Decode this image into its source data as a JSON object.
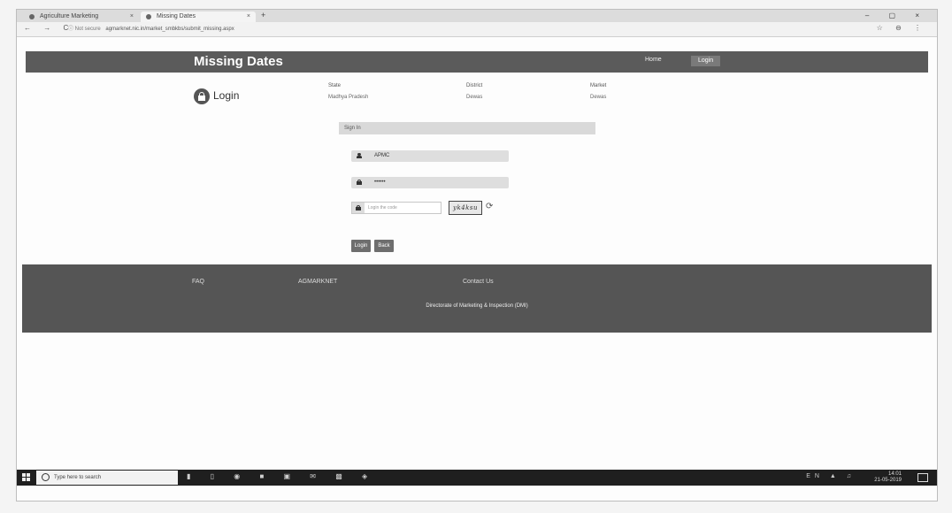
{
  "browser": {
    "tabs": [
      {
        "label": "Agriculture Marketing"
      },
      {
        "label": "Missing Dates"
      }
    ],
    "new_tab": "+",
    "window_controls": "–  ▢  ×",
    "nav": "←  →  C",
    "security": "ⓘ Not secure",
    "url": "agmarknet.nic.in/market_smbkbs/submit_missing.aspx",
    "right_icons": "☆  ⊖  ⋮"
  },
  "header": {
    "title": "Missing Dates",
    "home": "Home",
    "login": "Login"
  },
  "login_heading": "Login",
  "info": {
    "state_label": "State",
    "state_value": "Madhya Pradesh",
    "district_label": "District",
    "district_value": "Dewas",
    "market_label": "Market",
    "market_value": "Dewas"
  },
  "form": {
    "sign_in": "Sign In",
    "username": "APMC",
    "password": "••••••",
    "captcha_placeholder": "Login the code",
    "captcha_text": "yk4ksu",
    "login_button": "Login",
    "back_button": "Back"
  },
  "footer": {
    "links": [
      "FAQ",
      "AGMARKNET",
      "Contact Us"
    ],
    "copyright": "Directorate of Marketing & Inspection (DMI)"
  },
  "taskbar": {
    "search_placeholder": "Type here to search",
    "tray_time": "14:01",
    "tray_date": "21-05-2019",
    "tray_icons": "EN  ▲  ♫"
  }
}
